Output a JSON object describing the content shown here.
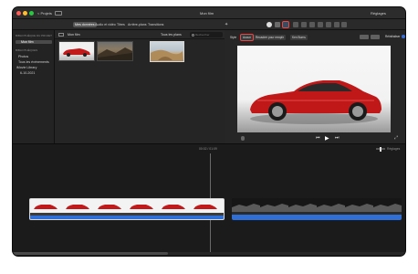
{
  "window": {
    "back_label": "< Projets",
    "title": "Mon film",
    "settings_label": "Réglages"
  },
  "toolbar": {
    "tabs": [
      "Mes données",
      "Audio et vidéo",
      "Titres",
      "Arrière-plans",
      "Transitions"
    ]
  },
  "sidebar": {
    "section_library": "BIBLIOTHÈQUE DU PROJET",
    "project_name": "Mon film",
    "section_libraries": "BIBLIOTHÈQUES",
    "items": [
      "Photos",
      "Tous les événements",
      "iMovie Library",
      "6-10-2021"
    ]
  },
  "browser": {
    "title": "Mon film",
    "filter": "Tous les plans",
    "search_placeholder": "Rechercher"
  },
  "viewer": {
    "buttons": [
      "Style",
      "Aucun",
      "Recadrer pour remplir",
      "Ken Burns"
    ],
    "reset_labels": [
      "Réinitialiser",
      "Tout"
    ]
  },
  "timeline": {
    "timecode": "00:02 / 01:09",
    "settings_label": "Réglages"
  },
  "colors": {
    "accent": "#2f6fd6",
    "window_bg": "#1e1e1e",
    "selection": "#e44444"
  }
}
